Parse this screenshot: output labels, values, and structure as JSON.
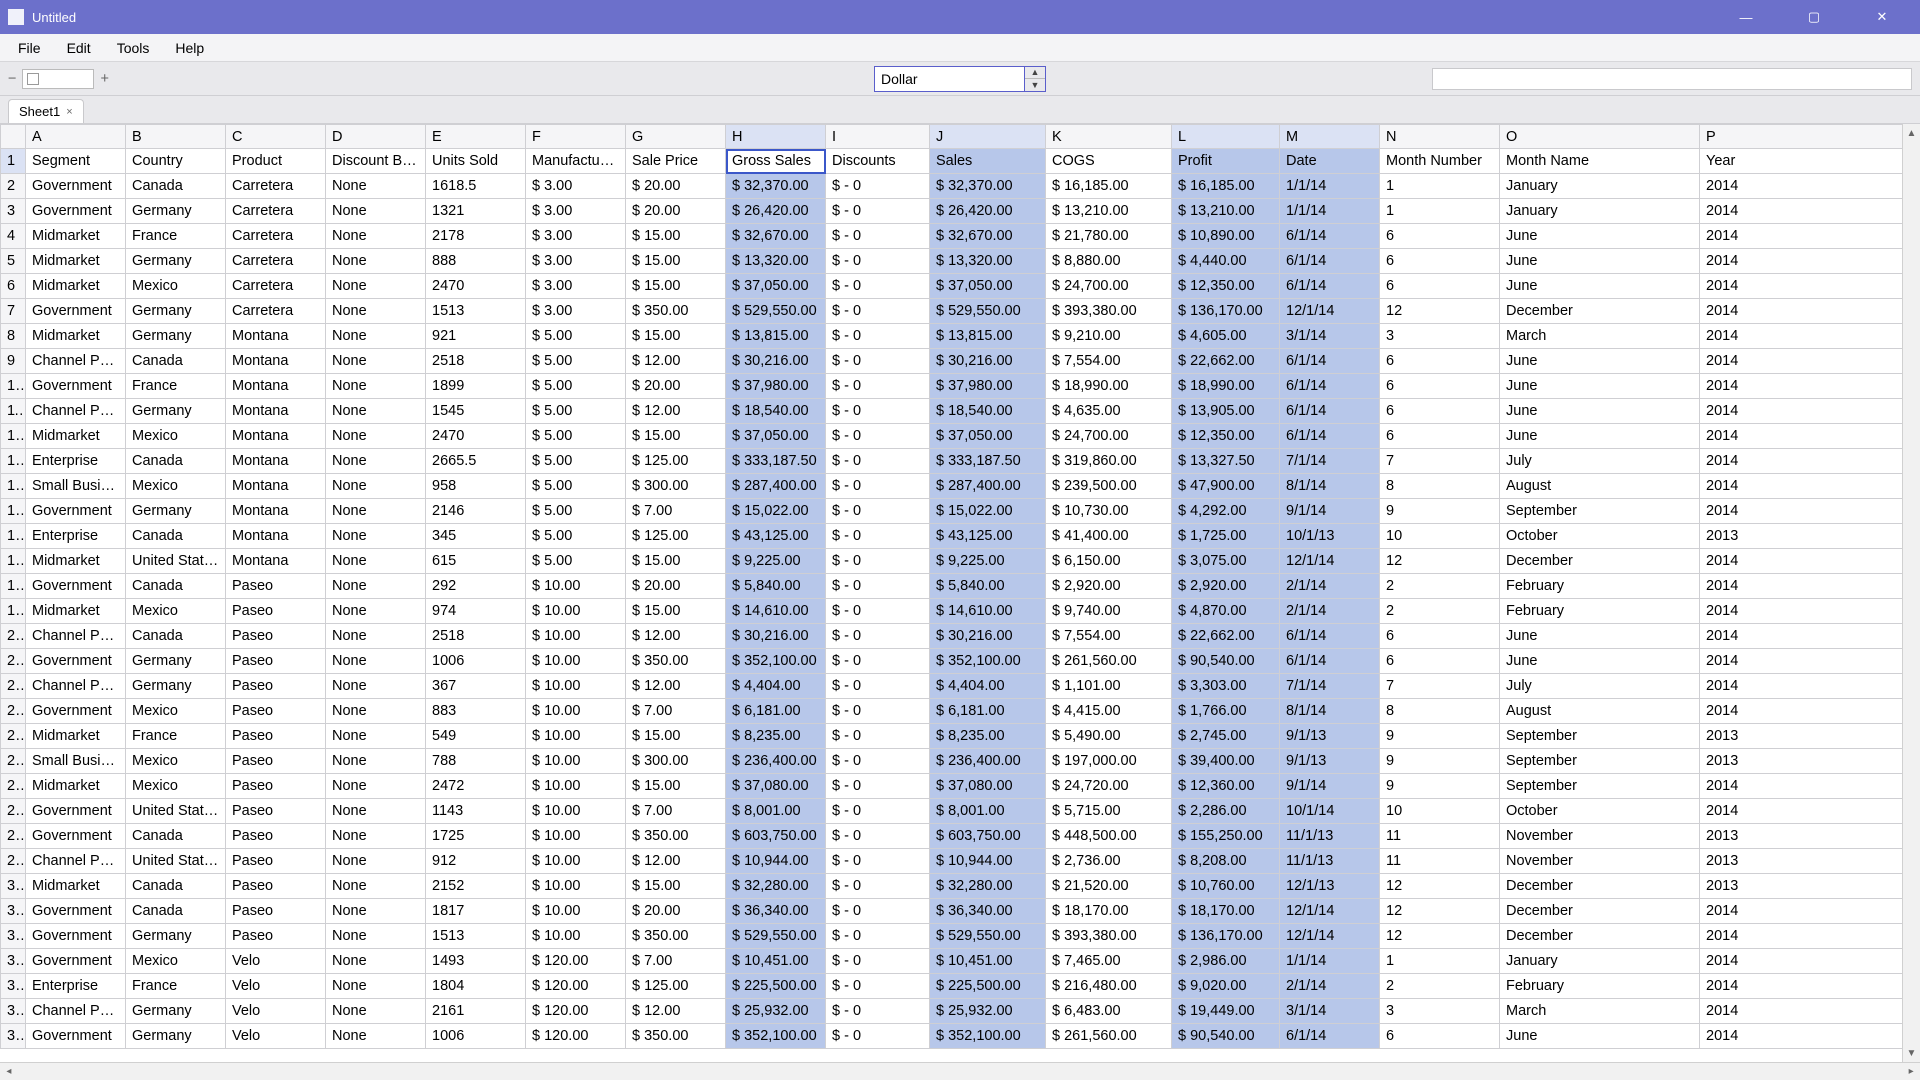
{
  "window": {
    "title": "Untitled"
  },
  "menu": {
    "file": "File",
    "edit": "Edit",
    "tools": "Tools",
    "help": "Help"
  },
  "toolbar": {
    "combo_value": "Dollar",
    "minus": "−",
    "plus": "+"
  },
  "tabs": {
    "sheet1": "Sheet1",
    "close": "×"
  },
  "window_controls": {
    "min": "—",
    "max": "▢",
    "close": "✕"
  },
  "columns": {
    "letters": [
      "A",
      "B",
      "C",
      "D",
      "E",
      "F",
      "G",
      "H",
      "I",
      "J",
      "K",
      "L",
      "M",
      "N",
      "O",
      "P"
    ],
    "selected_letters": [
      "H",
      "J",
      "L",
      "M"
    ]
  },
  "headers": [
    "Segment",
    "Country",
    "Product",
    "Discount Ba...",
    "Units Sold",
    "Manufacturi...",
    "Sale Price",
    "Gross Sales",
    "Discounts",
    "Sales",
    "COGS",
    "Profit",
    "Date",
    "Month Number",
    "Month Name",
    "Year"
  ],
  "selected_cols": [
    7,
    9,
    11,
    12
  ],
  "rows": [
    [
      "Government",
      "Canada",
      "Carretera",
      "None",
      "1618.5",
      "$   3.00",
      "$   20.00",
      "$   32,370.00",
      "$   - 0",
      "$   32,370.00",
      "$   16,185.00",
      "$   16,185.00",
      "1/1/14",
      "1",
      "January",
      "2014"
    ],
    [
      "Government",
      "Germany",
      "Carretera",
      "None",
      "1321",
      "$   3.00",
      "$   20.00",
      "$   26,420.00",
      "$   - 0",
      "$   26,420.00",
      "$   13,210.00",
      "$   13,210.00",
      "1/1/14",
      "1",
      "January",
      "2014"
    ],
    [
      "Midmarket",
      "France",
      "Carretera",
      "None",
      "2178",
      "$   3.00",
      "$   15.00",
      "$   32,670.00",
      "$   - 0",
      "$   32,670.00",
      "$   21,780.00",
      "$   10,890.00",
      "6/1/14",
      "6",
      "June",
      "2014"
    ],
    [
      "Midmarket",
      "Germany",
      "Carretera",
      "None",
      "888",
      "$   3.00",
      "$   15.00",
      "$   13,320.00",
      "$   - 0",
      "$   13,320.00",
      "$   8,880.00",
      "$   4,440.00",
      "6/1/14",
      "6",
      "June",
      "2014"
    ],
    [
      "Midmarket",
      "Mexico",
      "Carretera",
      "None",
      "2470",
      "$   3.00",
      "$   15.00",
      "$   37,050.00",
      "$   - 0",
      "$   37,050.00",
      "$   24,700.00",
      "$   12,350.00",
      "6/1/14",
      "6",
      "June",
      "2014"
    ],
    [
      "Government",
      "Germany",
      "Carretera",
      "None",
      "1513",
      "$   3.00",
      "$   350.00",
      "$   529,550.00",
      "$   - 0",
      "$   529,550.00",
      "$   393,380.00",
      "$   136,170.00",
      "12/1/14",
      "12",
      "December",
      "2014"
    ],
    [
      "Midmarket",
      "Germany",
      "Montana",
      "None",
      "921",
      "$   5.00",
      "$   15.00",
      "$   13,815.00",
      "$   - 0",
      "$   13,815.00",
      "$   9,210.00",
      "$   4,605.00",
      "3/1/14",
      "3",
      "March",
      "2014"
    ],
    [
      "Channel Par...",
      "Canada",
      "Montana",
      "None",
      "2518",
      "$   5.00",
      "$   12.00",
      "$   30,216.00",
      "$   - 0",
      "$   30,216.00",
      "$   7,554.00",
      "$   22,662.00",
      "6/1/14",
      "6",
      "June",
      "2014"
    ],
    [
      "Government",
      "France",
      "Montana",
      "None",
      "1899",
      "$   5.00",
      "$   20.00",
      "$   37,980.00",
      "$   - 0",
      "$   37,980.00",
      "$   18,990.00",
      "$   18,990.00",
      "6/1/14",
      "6",
      "June",
      "2014"
    ],
    [
      "Channel Par...",
      "Germany",
      "Montana",
      "None",
      "1545",
      "$   5.00",
      "$   12.00",
      "$   18,540.00",
      "$   - 0",
      "$   18,540.00",
      "$   4,635.00",
      "$   13,905.00",
      "6/1/14",
      "6",
      "June",
      "2014"
    ],
    [
      "Midmarket",
      "Mexico",
      "Montana",
      "None",
      "2470",
      "$   5.00",
      "$   15.00",
      "$   37,050.00",
      "$   - 0",
      "$   37,050.00",
      "$   24,700.00",
      "$   12,350.00",
      "6/1/14",
      "6",
      "June",
      "2014"
    ],
    [
      "Enterprise",
      "Canada",
      "Montana",
      "None",
      "2665.5",
      "$   5.00",
      "$   125.00",
      "$   333,187.50",
      "$   - 0",
      "$   333,187.50",
      "$   319,860.00",
      "$   13,327.50",
      "7/1/14",
      "7",
      "July",
      "2014"
    ],
    [
      "Small Busin...",
      "Mexico",
      "Montana",
      "None",
      "958",
      "$   5.00",
      "$   300.00",
      "$   287,400.00",
      "$   - 0",
      "$   287,400.00",
      "$   239,500.00",
      "$   47,900.00",
      "8/1/14",
      "8",
      "August",
      "2014"
    ],
    [
      "Government",
      "Germany",
      "Montana",
      "None",
      "2146",
      "$   5.00",
      "$   7.00",
      "$   15,022.00",
      "$   - 0",
      "$   15,022.00",
      "$   10,730.00",
      "$   4,292.00",
      "9/1/14",
      "9",
      "September",
      "2014"
    ],
    [
      "Enterprise",
      "Canada",
      "Montana",
      "None",
      "345",
      "$   5.00",
      "$   125.00",
      "$   43,125.00",
      "$   - 0",
      "$   43,125.00",
      "$   41,400.00",
      "$   1,725.00",
      "10/1/13",
      "10",
      "October",
      "2013"
    ],
    [
      "Midmarket",
      "United State...",
      "Montana",
      "None",
      "615",
      "$   5.00",
      "$   15.00",
      "$   9,225.00",
      "$   - 0",
      "$   9,225.00",
      "$   6,150.00",
      "$   3,075.00",
      "12/1/14",
      "12",
      "December",
      "2014"
    ],
    [
      "Government",
      "Canada",
      "Paseo",
      "None",
      "292",
      "$   10.00",
      "$   20.00",
      "$   5,840.00",
      "$   - 0",
      "$   5,840.00",
      "$   2,920.00",
      "$   2,920.00",
      "2/1/14",
      "2",
      "February",
      "2014"
    ],
    [
      "Midmarket",
      "Mexico",
      "Paseo",
      "None",
      "974",
      "$   10.00",
      "$   15.00",
      "$   14,610.00",
      "$   - 0",
      "$   14,610.00",
      "$   9,740.00",
      "$   4,870.00",
      "2/1/14",
      "2",
      "February",
      "2014"
    ],
    [
      "Channel Par...",
      "Canada",
      "Paseo",
      "None",
      "2518",
      "$   10.00",
      "$   12.00",
      "$   30,216.00",
      "$   - 0",
      "$   30,216.00",
      "$   7,554.00",
      "$   22,662.00",
      "6/1/14",
      "6",
      "June",
      "2014"
    ],
    [
      "Government",
      "Germany",
      "Paseo",
      "None",
      "1006",
      "$   10.00",
      "$   350.00",
      "$   352,100.00",
      "$   - 0",
      "$   352,100.00",
      "$   261,560.00",
      "$   90,540.00",
      "6/1/14",
      "6",
      "June",
      "2014"
    ],
    [
      "Channel Par...",
      "Germany",
      "Paseo",
      "None",
      "367",
      "$   10.00",
      "$   12.00",
      "$   4,404.00",
      "$   - 0",
      "$   4,404.00",
      "$   1,101.00",
      "$   3,303.00",
      "7/1/14",
      "7",
      "July",
      "2014"
    ],
    [
      "Government",
      "Mexico",
      "Paseo",
      "None",
      "883",
      "$   10.00",
      "$   7.00",
      "$   6,181.00",
      "$   - 0",
      "$   6,181.00",
      "$   4,415.00",
      "$   1,766.00",
      "8/1/14",
      "8",
      "August",
      "2014"
    ],
    [
      "Midmarket",
      "France",
      "Paseo",
      "None",
      "549",
      "$   10.00",
      "$   15.00",
      "$   8,235.00",
      "$   - 0",
      "$   8,235.00",
      "$   5,490.00",
      "$   2,745.00",
      "9/1/13",
      "9",
      "September",
      "2013"
    ],
    [
      "Small Busin...",
      "Mexico",
      "Paseo",
      "None",
      "788",
      "$   10.00",
      "$   300.00",
      "$   236,400.00",
      "$   - 0",
      "$   236,400.00",
      "$   197,000.00",
      "$   39,400.00",
      "9/1/13",
      "9",
      "September",
      "2013"
    ],
    [
      "Midmarket",
      "Mexico",
      "Paseo",
      "None",
      "2472",
      "$   10.00",
      "$   15.00",
      "$   37,080.00",
      "$   - 0",
      "$   37,080.00",
      "$   24,720.00",
      "$   12,360.00",
      "9/1/14",
      "9",
      "September",
      "2014"
    ],
    [
      "Government",
      "United State...",
      "Paseo",
      "None",
      "1143",
      "$   10.00",
      "$   7.00",
      "$   8,001.00",
      "$   - 0",
      "$   8,001.00",
      "$   5,715.00",
      "$   2,286.00",
      "10/1/14",
      "10",
      "October",
      "2014"
    ],
    [
      "Government",
      "Canada",
      "Paseo",
      "None",
      "1725",
      "$   10.00",
      "$   350.00",
      "$   603,750.00",
      "$   - 0",
      "$   603,750.00",
      "$   448,500.00",
      "$   155,250.00",
      "11/1/13",
      "11",
      "November",
      "2013"
    ],
    [
      "Channel Par...",
      "United State...",
      "Paseo",
      "None",
      "912",
      "$   10.00",
      "$   12.00",
      "$   10,944.00",
      "$   - 0",
      "$   10,944.00",
      "$   2,736.00",
      "$   8,208.00",
      "11/1/13",
      "11",
      "November",
      "2013"
    ],
    [
      "Midmarket",
      "Canada",
      "Paseo",
      "None",
      "2152",
      "$   10.00",
      "$   15.00",
      "$   32,280.00",
      "$   - 0",
      "$   32,280.00",
      "$   21,520.00",
      "$   10,760.00",
      "12/1/13",
      "12",
      "December",
      "2013"
    ],
    [
      "Government",
      "Canada",
      "Paseo",
      "None",
      "1817",
      "$   10.00",
      "$   20.00",
      "$   36,340.00",
      "$   - 0",
      "$   36,340.00",
      "$   18,170.00",
      "$   18,170.00",
      "12/1/14",
      "12",
      "December",
      "2014"
    ],
    [
      "Government",
      "Germany",
      "Paseo",
      "None",
      "1513",
      "$   10.00",
      "$   350.00",
      "$   529,550.00",
      "$   - 0",
      "$   529,550.00",
      "$   393,380.00",
      "$   136,170.00",
      "12/1/14",
      "12",
      "December",
      "2014"
    ],
    [
      "Government",
      "Mexico",
      "Velo",
      "None",
      "1493",
      "$   120.00",
      "$   7.00",
      "$   10,451.00",
      "$   - 0",
      "$   10,451.00",
      "$   7,465.00",
      "$   2,986.00",
      "1/1/14",
      "1",
      "January",
      "2014"
    ],
    [
      "Enterprise",
      "France",
      "Velo",
      "None",
      "1804",
      "$   120.00",
      "$   125.00",
      "$   225,500.00",
      "$   - 0",
      "$   225,500.00",
      "$   216,480.00",
      "$   9,020.00",
      "2/1/14",
      "2",
      "February",
      "2014"
    ],
    [
      "Channel Par...",
      "Germany",
      "Velo",
      "None",
      "2161",
      "$   120.00",
      "$   12.00",
      "$   25,932.00",
      "$   - 0",
      "$   25,932.00",
      "$   6,483.00",
      "$   19,449.00",
      "3/1/14",
      "3",
      "March",
      "2014"
    ],
    [
      "Government",
      "Germany",
      "Velo",
      "None",
      "1006",
      "$   120.00",
      "$   350.00",
      "$   352,100.00",
      "$   - 0",
      "$   352,100.00",
      "$   261,560.00",
      "$   90,540.00",
      "6/1/14",
      "6",
      "June",
      "2014"
    ]
  ]
}
